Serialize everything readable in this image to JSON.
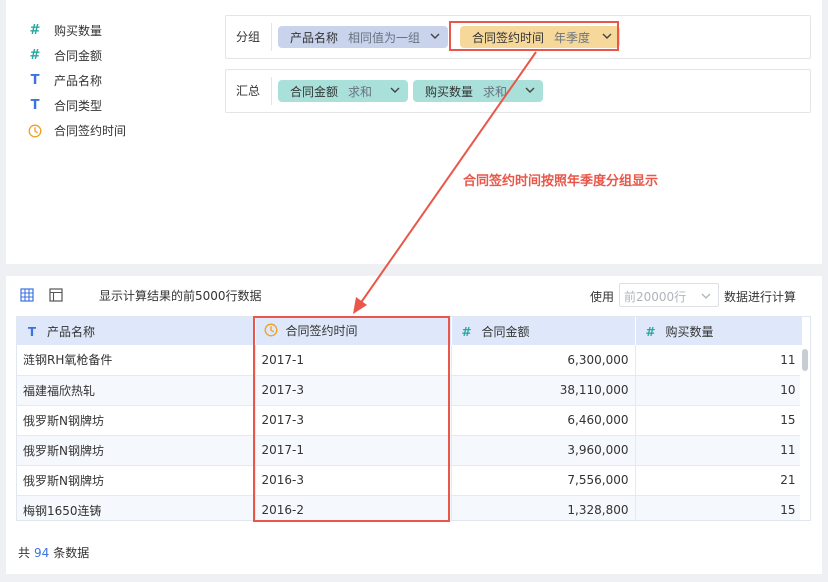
{
  "fields": [
    {
      "type": "number",
      "label": "购买数量"
    },
    {
      "type": "number",
      "label": "合同金额"
    },
    {
      "type": "text",
      "label": "产品名称"
    },
    {
      "type": "text",
      "label": "合同类型"
    },
    {
      "type": "time",
      "label": "合同签约时间"
    }
  ],
  "group_zone": {
    "label": "分组",
    "pills": [
      {
        "name": "产品名称",
        "mode": "相同值为一组"
      },
      {
        "name": "合同签约时间",
        "mode": "年季度"
      }
    ]
  },
  "summary_zone": {
    "label": "汇总",
    "pills": [
      {
        "name": "合同金额",
        "mode": "求和"
      },
      {
        "name": "购买数量",
        "mode": "求和"
      }
    ]
  },
  "annotation": "合同签约时间按照年季度分组显示",
  "toolbar": {
    "result_text": "显示计算结果的前5000行数据",
    "use_label": "使用",
    "row_placeholder": "前20000行",
    "calc_label": "数据进行计算"
  },
  "table": {
    "columns": [
      {
        "type": "text",
        "label": "产品名称"
      },
      {
        "type": "time",
        "label": "合同签约时间"
      },
      {
        "type": "number",
        "label": "合同金额"
      },
      {
        "type": "number",
        "label": "购买数量"
      }
    ],
    "rows": [
      [
        "涟钢RH氧枪备件",
        "2017-1",
        "6,300,000",
        "11"
      ],
      [
        "福建福欣热轧",
        "2017-3",
        "38,110,000",
        "10"
      ],
      [
        "俄罗斯N钢牌坊",
        "2017-3",
        "6,460,000",
        "15"
      ],
      [
        "俄罗斯N钢牌坊",
        "2017-1",
        "3,960,000",
        "11"
      ],
      [
        "俄罗斯N钢牌坊",
        "2016-3",
        "7,556,000",
        "21"
      ],
      [
        "梅钢1650连铸",
        "2016-2",
        "1,328,800",
        "15"
      ]
    ]
  },
  "footer": {
    "prefix": "共",
    "count": "94",
    "suffix": "条数据"
  },
  "colors": {
    "accent": "#3b73e0",
    "highlight": "#e8574a",
    "time_icon": "#f0a020",
    "number_icon": "#2aa7a0"
  },
  "icons": {
    "grid_view": "grid-view-icon",
    "layout": "layout-icon",
    "clock": "clock-icon",
    "chevron": "chevron-down-icon"
  }
}
